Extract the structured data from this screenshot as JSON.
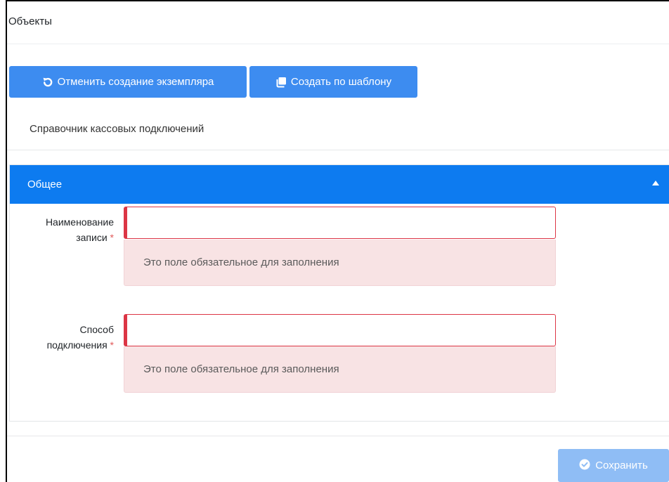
{
  "page": {
    "title": "Объекты"
  },
  "toolbar": {
    "cancel_label": "Отменить создание экземпляра",
    "cancel_icon": "undo-icon",
    "template_label": "Создать по шаблону",
    "template_icon": "copy-icon"
  },
  "reference": {
    "name": "Справочник кассовых подключений"
  },
  "panel": {
    "title": "Общее",
    "collapse_icon": "caret-up-icon",
    "fields": [
      {
        "label_line1": "Наименование",
        "label_line2": "записи",
        "required_mark": "*",
        "value": "",
        "error": "Это поле обязательное для заполнения"
      },
      {
        "label_line1": "Способ",
        "label_line2": "подключения",
        "required_mark": "*",
        "value": "",
        "error": "Это поле обязательное для заполнения"
      }
    ]
  },
  "footer": {
    "save_label": "Сохранить",
    "save_icon": "check-circle-icon"
  },
  "colors": {
    "primary": "#3d8cf0",
    "panel_header": "#0d7bf0",
    "disabled_primary": "#8fbdf5",
    "error_border": "#dc3545",
    "error_bg": "#f8e3e4"
  }
}
